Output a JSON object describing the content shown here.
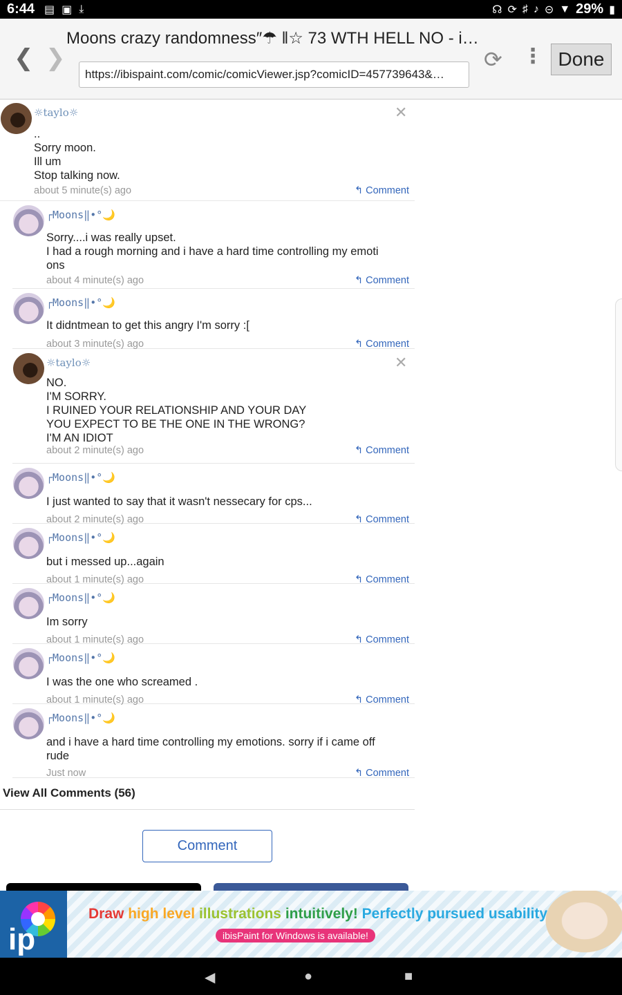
{
  "status_bar": {
    "time": "6:44",
    "battery": "29%",
    "icons": [
      "notification-icon",
      "image-icon",
      "download-icon",
      "headset-icon",
      "sync-icon",
      "bluetooth-icon",
      "mute-icon",
      "dnd-icon",
      "wifi-icon",
      "battery-icon"
    ]
  },
  "browser": {
    "title": "Moons crazy randomness″☂ ‖☆ 73 WTH HELL NO - i…",
    "url": "https://ibispaint.com/comic/comicViewer.jsp?comicID=457739643&…",
    "done_label": "Done"
  },
  "comments": [
    {
      "user": "☼taylo☼",
      "avatar": "taylo",
      "text": "..\nSorry moon.\nIll um\nStop talking now.",
      "time": "about 5 minute(s) ago",
      "closable": true
    },
    {
      "user": "┌Moons‖•°🌙",
      "avatar": "moons",
      "text": "Sorry....i was really upset.\nI had a rough morning and i have a hard time controlling my emoti\nons",
      "time": "about 4 minute(s) ago",
      "closable": false
    },
    {
      "user": "┌Moons‖•°🌙",
      "avatar": "moons",
      "text": "It didntmean to get this angry I'm sorry :[",
      "time": "about 3 minute(s) ago",
      "closable": false
    },
    {
      "user": "☼taylo☼",
      "avatar": "taylo",
      "text": "NO.\nI'M SORRY.\nI RUINED YOUR RELATIONSHIP AND YOUR DAY\nYOU EXPECT TO BE THE ONE IN THE WRONG?\nI'M AN IDIOT",
      "time": "about 2 minute(s) ago",
      "closable": true
    },
    {
      "user": "┌Moons‖•°🌙",
      "avatar": "moons",
      "text": "I just wanted to say that it wasn't nessecary for cps...",
      "time": "about 2 minute(s) ago",
      "closable": false
    },
    {
      "user": "┌Moons‖•°🌙",
      "avatar": "moons",
      "text": "but i messed up...again",
      "time": "about 1 minute(s) ago",
      "closable": false
    },
    {
      "user": "┌Moons‖•°🌙",
      "avatar": "moons",
      "text": "Im sorry",
      "time": "about 1 minute(s) ago",
      "closable": false
    },
    {
      "user": "┌Moons‖•°🌙",
      "avatar": "moons",
      "text": "I was the one who screamed .",
      "time": "about 1 minute(s) ago",
      "closable": false
    },
    {
      "user": "┌Moons‖•°🌙",
      "avatar": "moons",
      "text": "and i have a hard time controlling my emotions. sorry if i came off\nrude",
      "time": "Just now",
      "closable": false
    }
  ],
  "reply_label": "Comment",
  "view_all": "View All Comments (56)",
  "comment_button": "Comment",
  "ad": {
    "headline_words": [
      "Draw",
      "high",
      "level",
      "illustrations",
      "intuitively!",
      "Perfectly pursued usability!"
    ],
    "subline": "ibisPaint for Windows is available!",
    "logo_text": "ip"
  }
}
